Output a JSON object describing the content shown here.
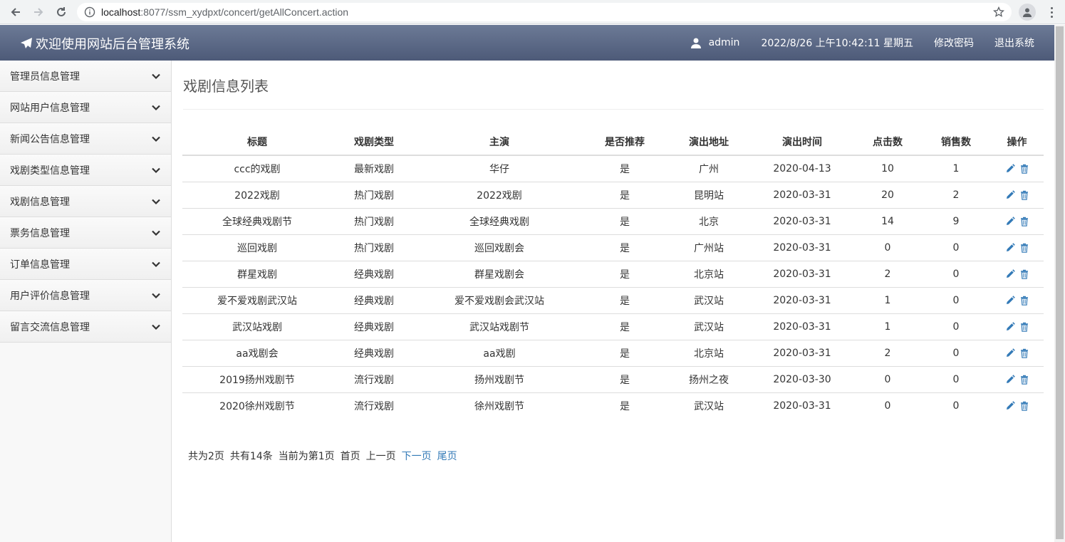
{
  "browser": {
    "url_host": "localhost",
    "url_path": ":8077/ssm_xydpxt/concert/getAllConcert.action"
  },
  "header": {
    "title": "欢迎使用网站后台管理系统",
    "user": "admin",
    "datetime": "2022/8/26 上午10:42:11 星期五",
    "change_password": "修改密码",
    "logout": "退出系统"
  },
  "sidebar": {
    "items": [
      {
        "label": "管理员信息管理"
      },
      {
        "label": "网站用户信息管理"
      },
      {
        "label": "新闻公告信息管理"
      },
      {
        "label": "戏剧类型信息管理"
      },
      {
        "label": "戏剧信息管理"
      },
      {
        "label": "票务信息管理"
      },
      {
        "label": "订单信息管理"
      },
      {
        "label": "用户评价信息管理"
      },
      {
        "label": "留言交流信息管理"
      }
    ]
  },
  "main": {
    "title": "戏剧信息列表",
    "columns": [
      "标题",
      "戏剧类型",
      "主演",
      "是否推荐",
      "演出地址",
      "演出时间",
      "点击数",
      "销售数",
      "操作"
    ],
    "rows": [
      [
        "ccc的戏剧",
        "最新戏剧",
        "华仔",
        "是",
        "广州",
        "2020-04-13",
        "10",
        "1"
      ],
      [
        "2022戏剧",
        "热门戏剧",
        "2022戏剧",
        "是",
        "昆明站",
        "2020-03-31",
        "20",
        "2"
      ],
      [
        "全球经典戏剧节",
        "热门戏剧",
        "全球经典戏剧",
        "是",
        "北京",
        "2020-03-31",
        "14",
        "9"
      ],
      [
        "巡回戏剧",
        "热门戏剧",
        "巡回戏剧会",
        "是",
        "广州站",
        "2020-03-31",
        "0",
        "0"
      ],
      [
        "群星戏剧",
        "经典戏剧",
        "群星戏剧会",
        "是",
        "北京站",
        "2020-03-31",
        "2",
        "0"
      ],
      [
        "爱不爱戏剧武汉站",
        "经典戏剧",
        "爱不爱戏剧会武汉站",
        "是",
        "武汉站",
        "2020-03-31",
        "1",
        "0"
      ],
      [
        "武汉站戏剧",
        "经典戏剧",
        "武汉站戏剧节",
        "是",
        "武汉站",
        "2020-03-31",
        "1",
        "0"
      ],
      [
        "aa戏剧会",
        "经典戏剧",
        "aa戏剧",
        "是",
        "北京站",
        "2020-03-31",
        "2",
        "0"
      ],
      [
        "2019扬州戏剧节",
        "流行戏剧",
        "扬州戏剧节",
        "是",
        "扬州之夜",
        "2020-03-30",
        "0",
        "0"
      ],
      [
        "2020徐州戏剧节",
        "流行戏剧",
        "徐州戏剧节",
        "是",
        "武汉站",
        "2020-03-31",
        "0",
        "0"
      ]
    ]
  },
  "pager": {
    "total_pages": "共为2页",
    "total_items": "共有14条",
    "current": "当前为第1页",
    "first": "首页",
    "prev": "上一页",
    "next": "下一页",
    "last": "尾页"
  },
  "colors": {
    "header_top": "#6c7a96",
    "header_bottom": "#4d5a78",
    "link": "#337ab7"
  }
}
